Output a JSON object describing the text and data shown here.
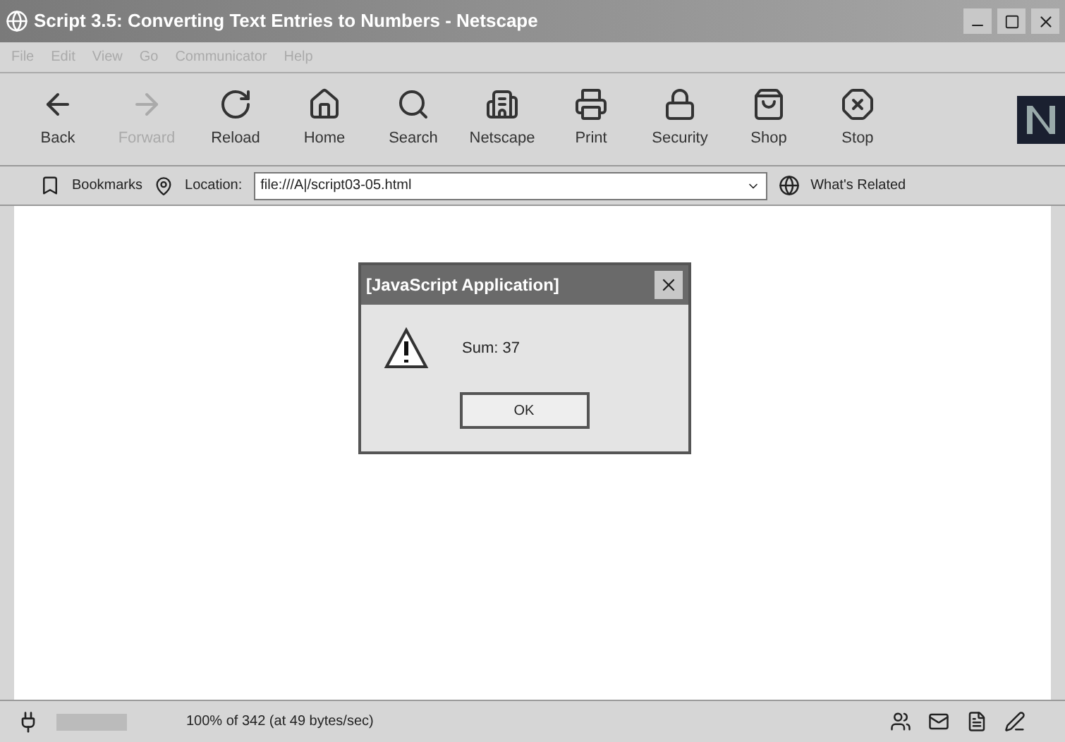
{
  "window": {
    "title": "Script 3.5: Converting Text Entries to Numbers - Netscape"
  },
  "menu": [
    "File",
    "Edit",
    "View",
    "Go",
    "Communicator",
    "Help"
  ],
  "toolbar": [
    {
      "label": "Back",
      "kind": "back",
      "disabled": false
    },
    {
      "label": "Forward",
      "kind": "forward",
      "disabled": true
    },
    {
      "label": "Reload",
      "kind": "reload",
      "disabled": false
    },
    {
      "label": "Home",
      "kind": "home",
      "disabled": false
    },
    {
      "label": "Search",
      "kind": "search",
      "disabled": false
    },
    {
      "label": "Netscape",
      "kind": "netscape",
      "disabled": false
    },
    {
      "label": "Print",
      "kind": "print",
      "disabled": false
    },
    {
      "label": "Security",
      "kind": "security",
      "disabled": false
    },
    {
      "label": "Shop",
      "kind": "shop",
      "disabled": false
    },
    {
      "label": "Stop",
      "kind": "stop",
      "disabled": false
    }
  ],
  "location_bar": {
    "bookmarks": "Bookmarks",
    "location_label": "Location:",
    "url": "file:///A|/script03-05.html",
    "related": "What's Related"
  },
  "dialog": {
    "title": "[JavaScript Application]",
    "message": "Sum: 37",
    "button": "OK"
  },
  "status_bar": {
    "text": "100% of 342 (at 49 bytes/sec)"
  }
}
